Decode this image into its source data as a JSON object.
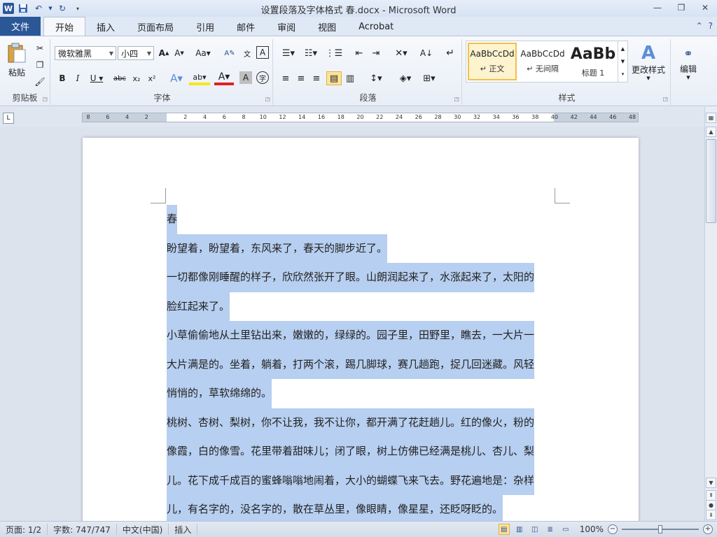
{
  "window": {
    "title": "设置段落及字体格式 春.docx - Microsoft Word",
    "app_logo": "W"
  },
  "tabs": [
    {
      "label": "文件"
    },
    {
      "label": "开始"
    },
    {
      "label": "插入"
    },
    {
      "label": "页面布局"
    },
    {
      "label": "引用"
    },
    {
      "label": "邮件"
    },
    {
      "label": "审阅"
    },
    {
      "label": "视图"
    },
    {
      "label": "Acrobat"
    }
  ],
  "ribbon": {
    "clipboard": {
      "label": "剪贴板",
      "paste": "粘贴"
    },
    "font": {
      "label": "字体",
      "font_name": "微软雅黑",
      "font_size": "小四"
    },
    "paragraph": {
      "label": "段落"
    },
    "styles": {
      "label": "样式",
      "items": [
        {
          "preview": "AaBbCcDd",
          "name": "↵ 正文"
        },
        {
          "preview": "AaBbCcDd",
          "name": "↵ 无间隔"
        },
        {
          "preview": "AaBb",
          "name": "标题 1"
        }
      ],
      "change_styles": "更改样式"
    },
    "editing": {
      "label": "编辑"
    }
  },
  "ruler": {
    "numbers": [
      "8",
      "6",
      "4",
      "2",
      "",
      "2",
      "4",
      "6",
      "8",
      "10",
      "12",
      "14",
      "16",
      "18",
      "20",
      "22",
      "24",
      "26",
      "28",
      "30",
      "32",
      "34",
      "36",
      "38",
      "40",
      "42",
      "44",
      "46",
      "48"
    ]
  },
  "document": {
    "lines": [
      "春",
      "盼望着，盼望着，东风来了，春天的脚步近了。",
      "一切都像刚睡醒的样子，欣欣然张开了眼。山朗润起来了，水涨起来了，太阳的",
      "脸红起来了。",
      "小草偷偷地从土里钻出来，嫩嫩的，绿绿的。园子里，田野里，瞧去，一大片一",
      "大片满是的。坐着，躺着，打两个滚，踢几脚球，赛几趟跑，捉几回迷藏。风轻",
      "悄悄的，草软绵绵的。",
      "桃树、杏树、梨树，你不让我，我不让你，都开满了花赶趟儿。红的像火，粉的",
      "像霞，白的像雪。花里带着甜味儿；闭了眼，树上仿佛已经满是桃儿、杏儿、梨",
      "儿。花下成千成百的蜜蜂嗡嗡地闹着，大小的蝴蝶飞来飞去。野花遍地是：杂样",
      "儿，有名字的，没名字的，散在草丛里，像眼睛，像星星，还眨呀眨的。"
    ]
  },
  "status": {
    "page": "页面: 1/2",
    "words": "字数: 747/747",
    "language": "中文(中国)",
    "mode": "插入",
    "zoom": "100%",
    "zoom_level": 0.5
  }
}
